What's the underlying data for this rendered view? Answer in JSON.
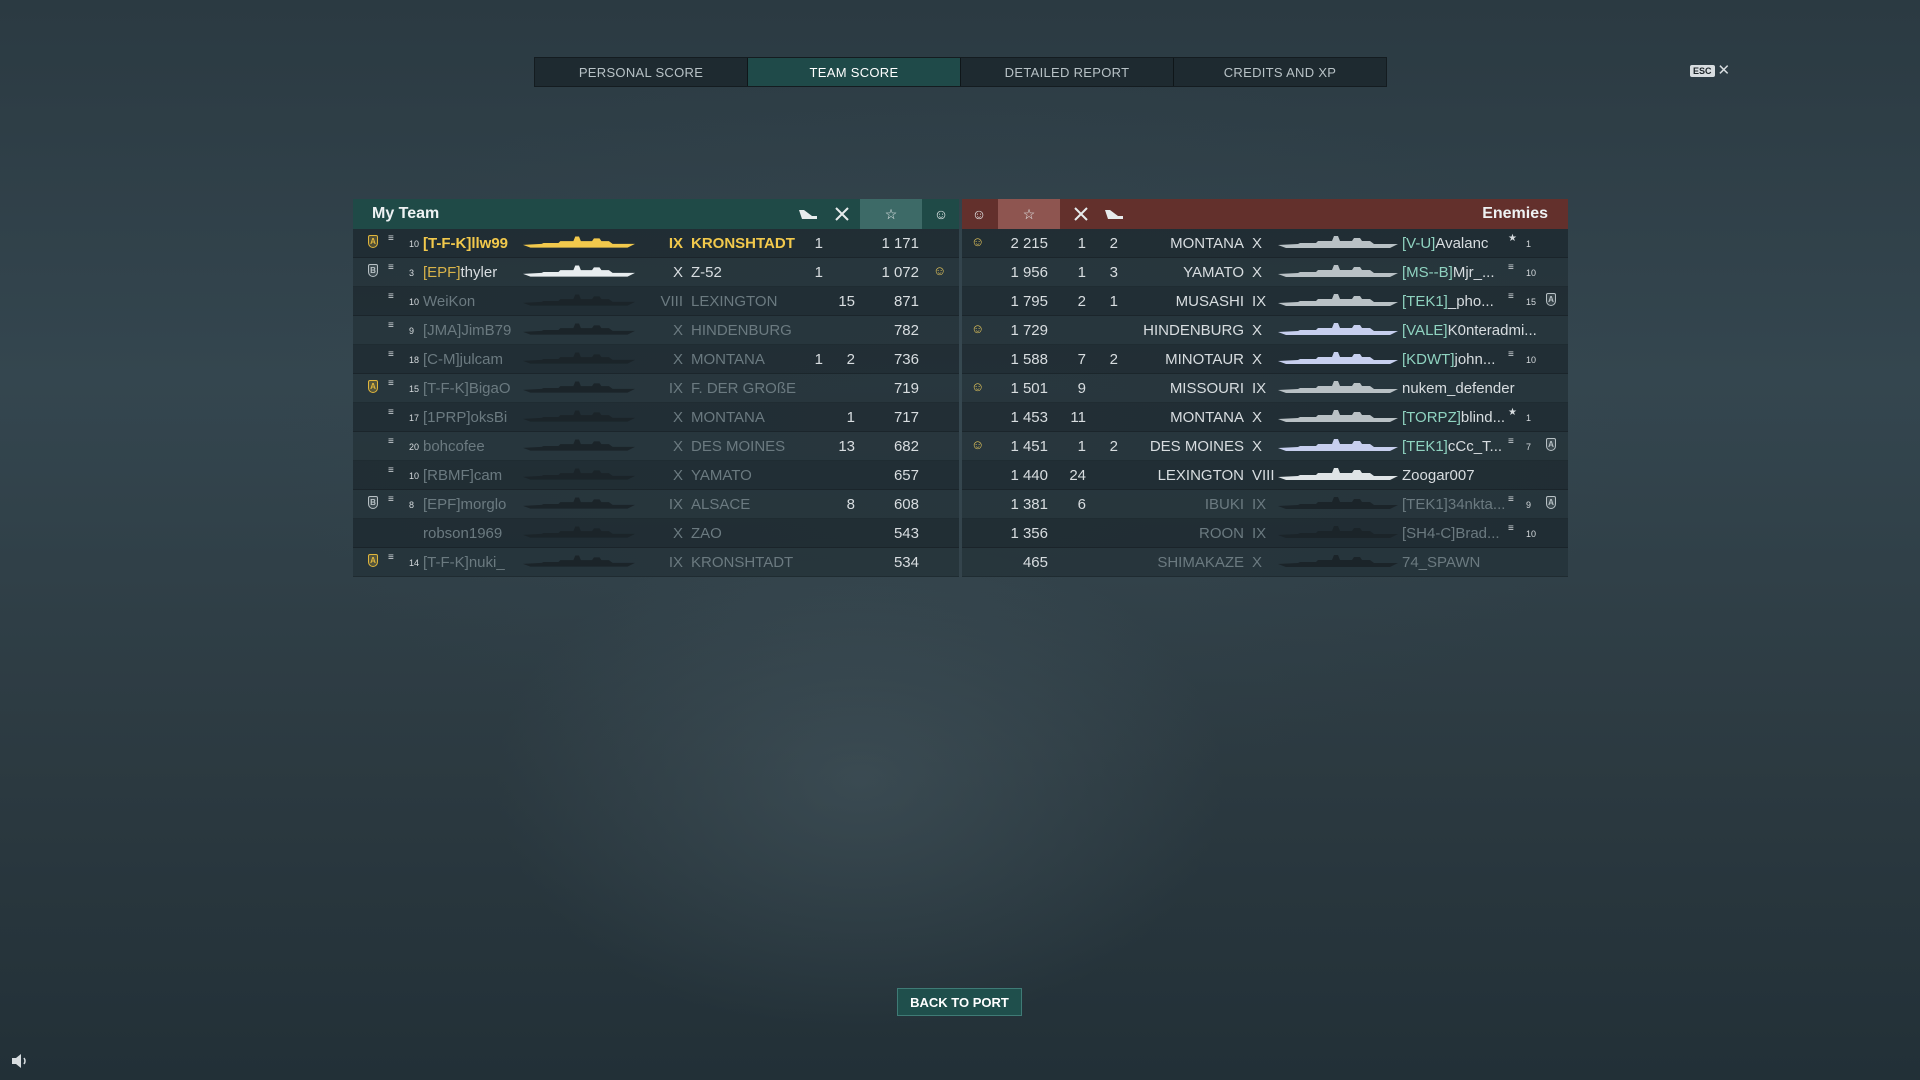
{
  "tabs": [
    {
      "label": "PERSONAL SCORE",
      "active": false
    },
    {
      "label": "TEAM SCORE",
      "active": true
    },
    {
      "label": "DETAILED REPORT",
      "active": false
    },
    {
      "label": "CREDITS AND XP",
      "active": false
    }
  ],
  "esc": {
    "key": "ESC",
    "close": "✕"
  },
  "my_team": {
    "title": "My Team",
    "rows": [
      {
        "badge": "A",
        "badge_color": "gold",
        "rank": "10",
        "clan": "[T-F-K]",
        "name": "llw99",
        "tier": "IX",
        "ship": "KRONSHTADT",
        "planes": "1",
        "kills": "",
        "xp": "1 171",
        "dice": "",
        "style": "self",
        "ship_color": "#f2c94c"
      },
      {
        "badge": "B",
        "badge_color": "grey",
        "rank": "3",
        "clan": "[EPF]",
        "name": "thyler",
        "tier": "X",
        "ship": "Z-52",
        "planes": "1",
        "kills": "",
        "xp": "1 072",
        "dice": "☺",
        "style": "alive",
        "ship_color": "#e8edef"
      },
      {
        "badge": "",
        "badge_color": "",
        "rank": "10",
        "clan": "",
        "name": "WeiKon",
        "tier": "VIII",
        "ship": "LEXINGTON",
        "planes": "",
        "kills": "15",
        "xp": "871",
        "dice": "",
        "style": "dead",
        "ship_color": "#1b2429"
      },
      {
        "badge": "",
        "badge_color": "",
        "rank": "9",
        "clan": "[JMA]",
        "name": "JimB79",
        "tier": "X",
        "ship": "HINDENBURG",
        "planes": "",
        "kills": "",
        "xp": "782",
        "dice": "",
        "style": "dead",
        "ship_color": "#1b2429"
      },
      {
        "badge": "",
        "badge_color": "",
        "rank": "18",
        "clan": "[C-M]",
        "name": "julcam",
        "tier": "X",
        "ship": "MONTANA",
        "planes": "1",
        "kills": "2",
        "xp": "736",
        "dice": "",
        "style": "dead",
        "ship_color": "#1b2429"
      },
      {
        "badge": "A",
        "badge_color": "gold",
        "rank": "15",
        "clan": "[T-F-K]",
        "name": "BigaO",
        "tier": "IX",
        "ship": "F. DER GROßE",
        "planes": "",
        "kills": "",
        "xp": "719",
        "dice": "",
        "style": "dead",
        "ship_color": "#1b2429"
      },
      {
        "badge": "",
        "badge_color": "",
        "rank": "17",
        "clan": "[1PRP]",
        "name": "oksBi",
        "tier": "X",
        "ship": "MONTANA",
        "planes": "",
        "kills": "1",
        "xp": "717",
        "dice": "",
        "style": "dead",
        "ship_color": "#1b2429"
      },
      {
        "badge": "",
        "badge_color": "",
        "rank": "20",
        "clan": "",
        "name": "bohcofee",
        "tier": "X",
        "ship": "DES MOINES",
        "planes": "",
        "kills": "13",
        "xp": "682",
        "dice": "",
        "style": "dead",
        "ship_color": "#1b2429"
      },
      {
        "badge": "",
        "badge_color": "",
        "rank": "10",
        "clan": "[RBMF]",
        "name": "cam",
        "tier": "X",
        "ship": "YAMATO",
        "planes": "",
        "kills": "",
        "xp": "657",
        "dice": "",
        "style": "dead",
        "ship_color": "#1b2429"
      },
      {
        "badge": "B",
        "badge_color": "grey",
        "rank": "8",
        "clan": "[EPF]",
        "name": "morglo",
        "tier": "IX",
        "ship": "ALSACE",
        "planes": "",
        "kills": "8",
        "xp": "608",
        "dice": "",
        "style": "dead",
        "ship_color": "#1b2429"
      },
      {
        "badge": "",
        "badge_color": "",
        "rank": "",
        "clan": "",
        "name": "robson1969",
        "tier": "X",
        "ship": "ZAO",
        "planes": "",
        "kills": "",
        "xp": "543",
        "dice": "",
        "style": "dead",
        "ship_color": "#1b2429"
      },
      {
        "badge": "A",
        "badge_color": "gold",
        "rank": "14",
        "clan": "[T-F-K]",
        "name": "nuki_",
        "tier": "IX",
        "ship": "KRONSHTADT",
        "planes": "",
        "kills": "",
        "xp": "534",
        "dice": "",
        "style": "dead",
        "ship_color": "#1b2429"
      }
    ]
  },
  "enemies": {
    "title": "Enemies",
    "rows": [
      {
        "dice": "☺",
        "xp": "2 215",
        "kills": "1",
        "planes": "2",
        "ship": "MONTANA",
        "tier": "X",
        "clan": "[V-U]",
        "name": "Avalanc",
        "rank": "1",
        "rank_type": "star",
        "badge": "",
        "style": "alive",
        "ship_color": "#b9c1c5"
      },
      {
        "dice": "",
        "xp": "1 956",
        "kills": "1",
        "planes": "3",
        "ship": "YAMATO",
        "tier": "X",
        "clan": "[MS--B]",
        "name": "Mjr_...",
        "rank": "10",
        "rank_type": "bars",
        "badge": "",
        "style": "alive",
        "ship_color": "#b9c1c5"
      },
      {
        "dice": "",
        "xp": "1 795",
        "kills": "2",
        "planes": "1",
        "ship": "MUSASHI",
        "tier": "IX",
        "clan": "[TEK1]",
        "name": "_pho...",
        "rank": "15",
        "rank_type": "bars",
        "badge": "A",
        "style": "alive",
        "ship_color": "#b9c1c5"
      },
      {
        "dice": "☺",
        "xp": "1 729",
        "kills": "",
        "planes": "",
        "ship": "HINDENBURG",
        "tier": "X",
        "clan": "[VALE]",
        "name": "K0nteradmi...",
        "rank": "",
        "rank_type": "",
        "badge": "",
        "style": "alive",
        "ship_color": "#c7cfee"
      },
      {
        "dice": "",
        "xp": "1 588",
        "kills": "7",
        "planes": "2",
        "ship": "MINOTAUR",
        "tier": "X",
        "clan": "[KDWT]",
        "name": "john...",
        "rank": "10",
        "rank_type": "bars",
        "badge": "",
        "style": "alive",
        "ship_color": "#c7cfee"
      },
      {
        "dice": "☺",
        "xp": "1 501",
        "kills": "9",
        "planes": "",
        "ship": "MISSOURI",
        "tier": "IX",
        "clan": "",
        "name": "nukem_defender",
        "rank": "",
        "rank_type": "",
        "badge": "",
        "style": "alive",
        "ship_color": "#b9c1c5"
      },
      {
        "dice": "",
        "xp": "1 453",
        "kills": "11",
        "planes": "",
        "ship": "MONTANA",
        "tier": "X",
        "clan": "[TORPZ]",
        "name": "blind...",
        "rank": "1",
        "rank_type": "star",
        "badge": "",
        "style": "alive",
        "ship_color": "#b9c1c5"
      },
      {
        "dice": "☺",
        "xp": "1 451",
        "kills": "1",
        "planes": "2",
        "ship": "DES MOINES",
        "tier": "X",
        "clan": "[TEK1]",
        "name": "cCc_T...",
        "rank": "7",
        "rank_type": "bars",
        "badge": "A",
        "style": "alive",
        "ship_color": "#c7cfee"
      },
      {
        "dice": "",
        "xp": "1 440",
        "kills": "24",
        "planes": "",
        "ship": "LEXINGTON",
        "tier": "VIII",
        "clan": "",
        "name": "Zoogar007",
        "rank": "",
        "rank_type": "",
        "badge": "",
        "style": "alive",
        "ship_color": "#dfe4e6"
      },
      {
        "dice": "",
        "xp": "1 381",
        "kills": "6",
        "planes": "",
        "ship": "IBUKI",
        "tier": "IX",
        "clan": "[TEK1]",
        "name": "34nkta...",
        "rank": "9",
        "rank_type": "bars",
        "badge": "A",
        "style": "dead",
        "ship_color": "#1b2429"
      },
      {
        "dice": "",
        "xp": "1 356",
        "kills": "",
        "planes": "",
        "ship": "ROON",
        "tier": "IX",
        "clan": "[SH4-C]",
        "name": "Brad...",
        "rank": "10",
        "rank_type": "bars",
        "badge": "",
        "style": "dead",
        "ship_color": "#1b2429"
      },
      {
        "dice": "",
        "xp": "465",
        "kills": "",
        "planes": "",
        "ship": "SHIMAKAZE",
        "tier": "X",
        "clan": "",
        "name": "74_SPAWN",
        "rank": "",
        "rank_type": "",
        "badge": "",
        "style": "dead",
        "ship_color": "#1b2429"
      }
    ]
  },
  "icons": {
    "planes": "✈",
    "kills": "✖",
    "xp": "☆",
    "dice": "☺"
  },
  "back_button": "BACK TO PORT"
}
